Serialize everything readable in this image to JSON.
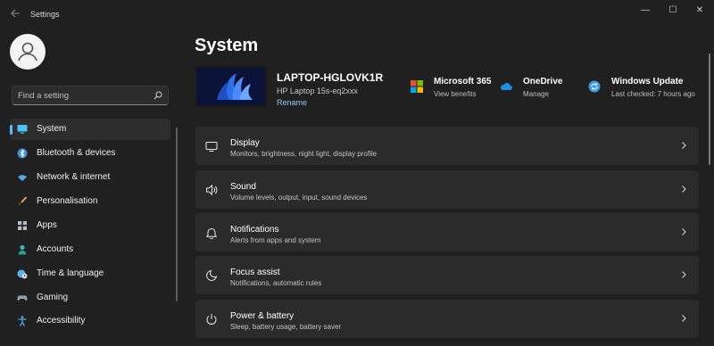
{
  "window": {
    "title": "Settings",
    "minimize_glyph": "—",
    "maximize_glyph": "☐",
    "close_glyph": "✕"
  },
  "search": {
    "placeholder": "Find a setting"
  },
  "sidebar": {
    "items": [
      {
        "label": "System",
        "icon": "monitor-icon",
        "selected": true
      },
      {
        "label": "Bluetooth & devices",
        "icon": "bluetooth-icon"
      },
      {
        "label": "Network & internet",
        "icon": "wifi-icon"
      },
      {
        "label": "Personalisation",
        "icon": "brush-icon"
      },
      {
        "label": "Apps",
        "icon": "apps-icon"
      },
      {
        "label": "Accounts",
        "icon": "accounts-icon"
      },
      {
        "label": "Time & language",
        "icon": "globe-clock-icon"
      },
      {
        "label": "Gaming",
        "icon": "gamepad-icon"
      },
      {
        "label": "Accessibility",
        "icon": "accessibility-icon"
      }
    ]
  },
  "main": {
    "title": "System",
    "device": {
      "name": "LAPTOP-HGLOVK1R",
      "model": "HP Laptop 15s-eq2xxx",
      "rename_label": "Rename"
    },
    "services": [
      {
        "title": "Microsoft 365",
        "subtitle": "View benefits",
        "icon": "microsoft-logo-icon"
      },
      {
        "title": "OneDrive",
        "subtitle": "Manage",
        "icon": "onedrive-cloud-icon"
      },
      {
        "title": "Windows Update",
        "subtitle": "Last checked: 7 hours ago",
        "icon": "update-icon"
      }
    ],
    "cards": [
      {
        "title": "Display",
        "subtitle": "Monitors, brightness, night light, display profile",
        "icon": "display-icon"
      },
      {
        "title": "Sound",
        "subtitle": "Volume levels, output, input, sound devices",
        "icon": "speaker-icon"
      },
      {
        "title": "Notifications",
        "subtitle": "Alerts from apps and system",
        "icon": "bell-icon"
      },
      {
        "title": "Focus assist",
        "subtitle": "Notifications, automatic rules",
        "icon": "moon-icon"
      },
      {
        "title": "Power & battery",
        "subtitle": "Sleep, battery usage, battery saver",
        "icon": "power-icon"
      }
    ]
  },
  "colors": {
    "accent": "#4cc2ff",
    "background": "#202020",
    "card": "#2b2b2b",
    "link": "#8fc7f0"
  }
}
